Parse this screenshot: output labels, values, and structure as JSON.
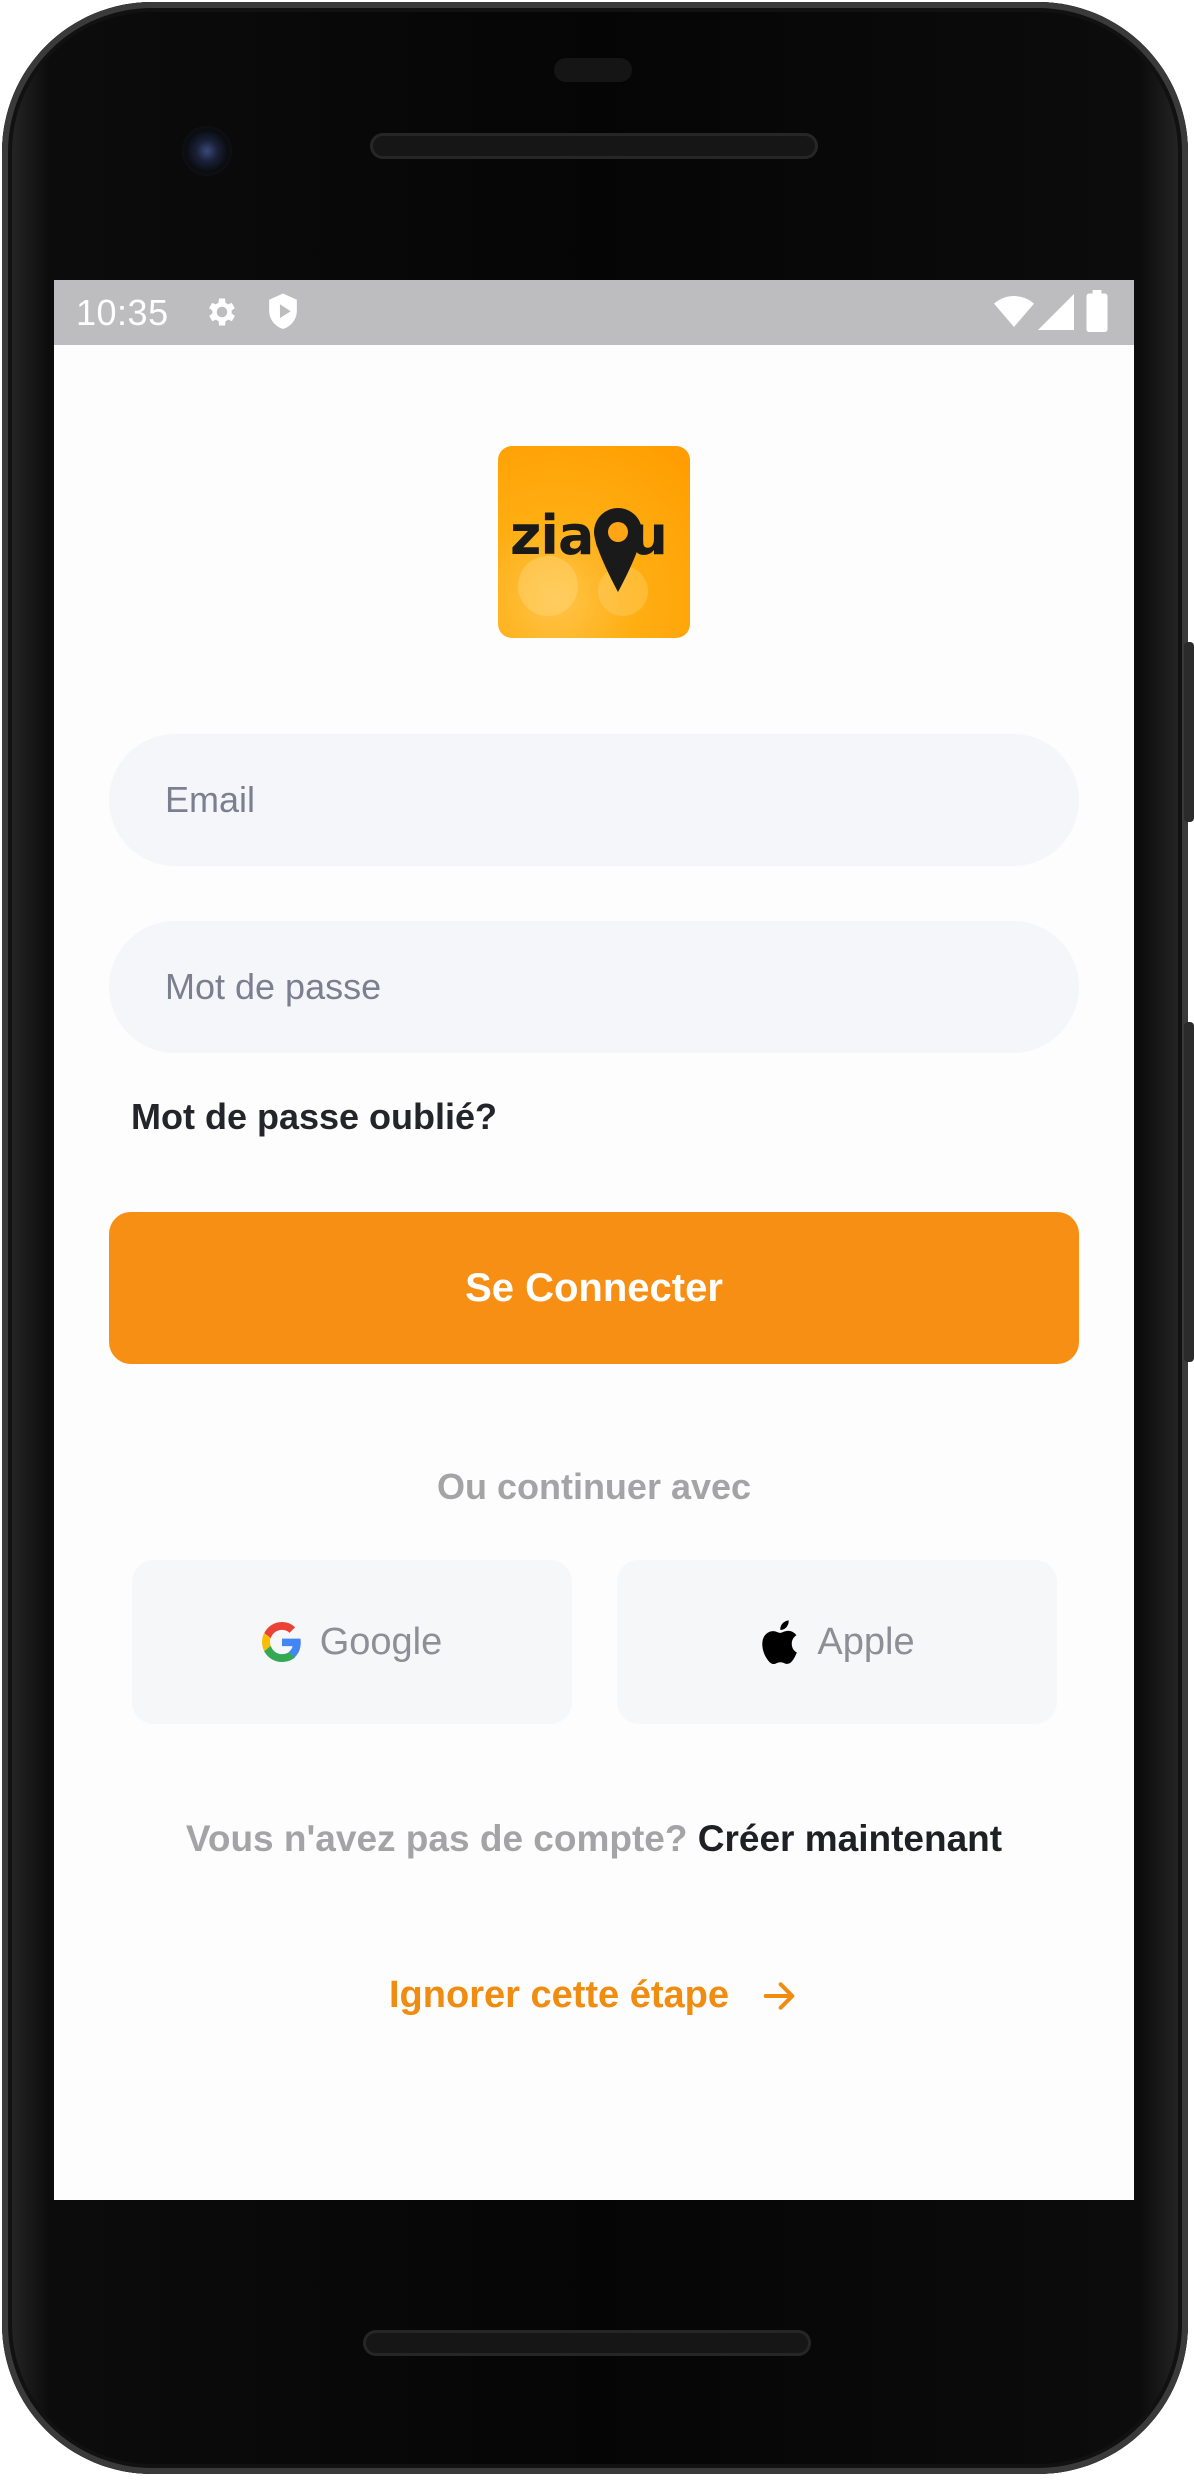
{
  "status_bar": {
    "time": "10:35",
    "left_icons": [
      "gear-icon",
      "shield-play-icon"
    ],
    "right_icons": [
      "wifi-icon",
      "signal-icon",
      "battery-icon"
    ],
    "background": "#bdbcbe"
  },
  "logo": {
    "text": "ziaou",
    "background": "#ff9b00"
  },
  "form": {
    "email_placeholder": "Email",
    "password_placeholder": "Mot de passe",
    "forgot_label": "Mot de passe oublié?",
    "login_label": "Se Connecter"
  },
  "social": {
    "divider_text": "Ou continuer avec",
    "google_label": "Google",
    "google_icon": "google-icon",
    "apple_label": "Apple",
    "apple_icon": "apple-icon"
  },
  "signup": {
    "question": "Vous n'avez pas de compte?",
    "link": "Créer maintenant"
  },
  "skip": {
    "label": "Ignorer cette étape",
    "icon": "arrow-right-icon"
  },
  "colors": {
    "accent": "#f78f14",
    "input_bg": "#f5f6f9",
    "muted_text": "#a4a4a6",
    "dark_text": "#23252b"
  }
}
